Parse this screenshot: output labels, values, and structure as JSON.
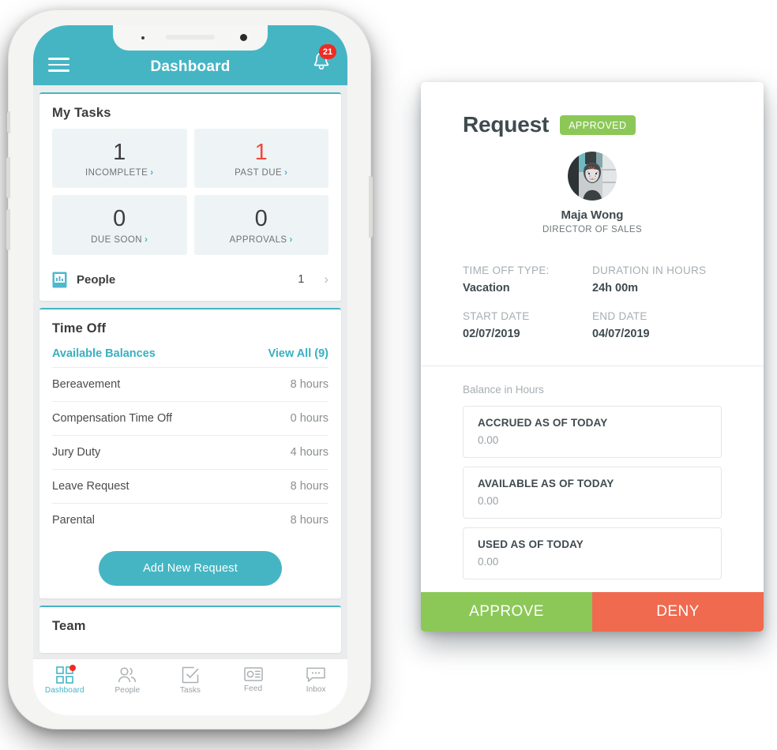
{
  "phone": {
    "header": {
      "title": "Dashboard",
      "menu_icon": "hamburger-menu-icon",
      "notifications_icon": "bell-icon",
      "notification_count": "21"
    },
    "my_tasks": {
      "title": "My Tasks",
      "tiles": [
        {
          "count": "1",
          "label": "INCOMPLETE",
          "chevron": "›",
          "danger": false
        },
        {
          "count": "1",
          "label": "PAST DUE",
          "chevron": "›",
          "danger": true
        },
        {
          "count": "0",
          "label": "DUE SOON",
          "chevron": "›",
          "danger": false
        },
        {
          "count": "0",
          "label": "APPROVALS",
          "chevron": "›",
          "danger": false
        }
      ],
      "people_row": {
        "icon": "people-book-icon",
        "label": "People",
        "count": "1",
        "chevron": "›"
      }
    },
    "time_off": {
      "title": "Time Off",
      "subtitle": "Available Balances",
      "view_all": "View All (9)",
      "balances": [
        {
          "name": "Bereavement",
          "value": "8 hours"
        },
        {
          "name": "Compensation Time Off",
          "value": "0 hours"
        },
        {
          "name": "Jury Duty",
          "value": "4 hours"
        },
        {
          "name": "Leave Request",
          "value": "8 hours"
        },
        {
          "name": "Parental",
          "value": "8 hours"
        }
      ],
      "add_button": "Add New Request"
    },
    "team": {
      "title": "Team"
    },
    "tab_bar": [
      {
        "label": "Dashboard",
        "icon": "grid-icon",
        "active": true,
        "dot": true
      },
      {
        "label": "People",
        "icon": "people-icon",
        "active": false,
        "dot": false
      },
      {
        "label": "Tasks",
        "icon": "checkbox-icon",
        "active": false,
        "dot": false
      },
      {
        "label": "Feed",
        "icon": "news-feed-icon",
        "active": false,
        "dot": false
      },
      {
        "label": "Inbox",
        "icon": "chat-bubble-icon",
        "active": false,
        "dot": false
      }
    ]
  },
  "request_panel": {
    "title": "Request",
    "status": "APPROVED",
    "requester": {
      "name": "Maja Wong",
      "role": "DIRECTOR OF SALES"
    },
    "details": [
      {
        "label": "TIME OFF TYPE:",
        "value": "Vacation"
      },
      {
        "label": "DURATION IN HOURS",
        "value": "24h 00m"
      },
      {
        "label": "START DATE",
        "value": "02/07/2019"
      },
      {
        "label": "END DATE",
        "value": "04/07/2019"
      }
    ],
    "balance_heading": "Balance in Hours",
    "balance_cards": [
      {
        "title": "ACCRUED AS OF TODAY",
        "value": "0.00"
      },
      {
        "title": "AVAILABLE AS OF TODAY",
        "value": "0.00"
      },
      {
        "title": "USED AS OF TODAY",
        "value": "0.00"
      }
    ],
    "approve_label": "APPROVE",
    "deny_label": "DENY"
  },
  "colors": {
    "teal": "#45b5c4",
    "green": "#8cc857",
    "red": "#ef6a4f",
    "badge_red": "#f02b22",
    "danger_text": "#f4483b"
  }
}
